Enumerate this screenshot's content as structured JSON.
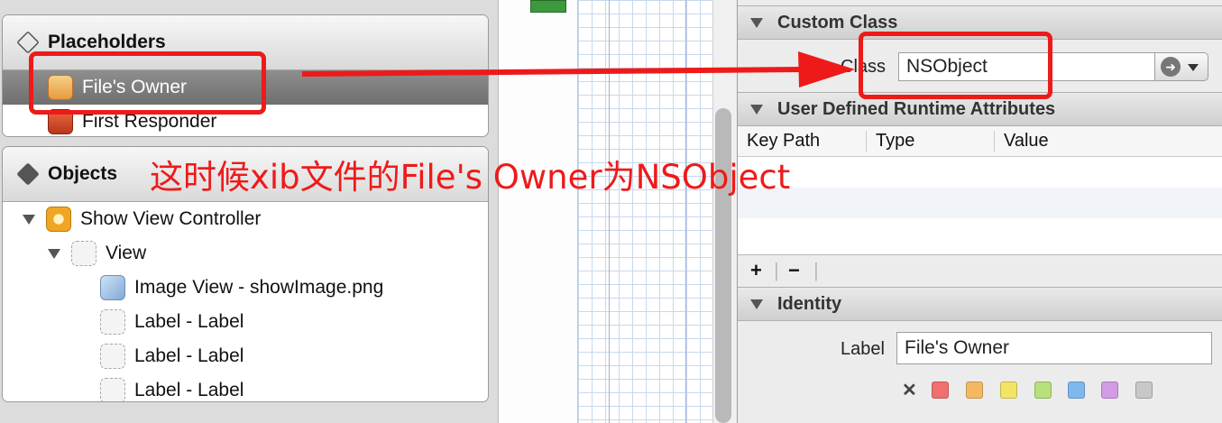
{
  "left_panel": {
    "placeholders_title": "Placeholders",
    "placeholders": [
      {
        "label": "File's Owner",
        "selected": true,
        "icon": "files-owner-cube-icon"
      },
      {
        "label": "First Responder",
        "selected": false,
        "icon": "first-responder-cube-icon"
      }
    ],
    "objects_title": "Objects",
    "tree": [
      {
        "label": "Show View Controller",
        "icon": "view-controller-icon",
        "expanded": true
      },
      {
        "label": "View",
        "icon": "view-icon",
        "expanded": true
      },
      {
        "label": "Image View - showImage.png",
        "icon": "image-view-icon"
      },
      {
        "label": "Label - Label",
        "icon": "label-icon"
      },
      {
        "label": "Label - Label",
        "icon": "label-icon"
      },
      {
        "label": "Label - Label",
        "icon": "label-icon"
      }
    ]
  },
  "annotation": {
    "text": "这时候xib文件的File's Owner为NSObject",
    "color": "#ee1a1a"
  },
  "inspector": {
    "custom_class": {
      "title": "Custom Class",
      "class_label": "Class",
      "class_value": "NSObject"
    },
    "runtime_attributes": {
      "title": "User Defined Runtime Attributes",
      "columns": [
        "Key Path",
        "Type",
        "Value"
      ],
      "add_label": "+",
      "remove_label": "−"
    },
    "identity": {
      "title": "Identity",
      "label_label": "Label",
      "label_value": "File's Owner",
      "clear_label": "✕",
      "label_colors": [
        "#f07070",
        "#f5b862",
        "#f2e566",
        "#b6e07a",
        "#7db8ef",
        "#d39be6",
        "#c8c8c8"
      ]
    }
  }
}
